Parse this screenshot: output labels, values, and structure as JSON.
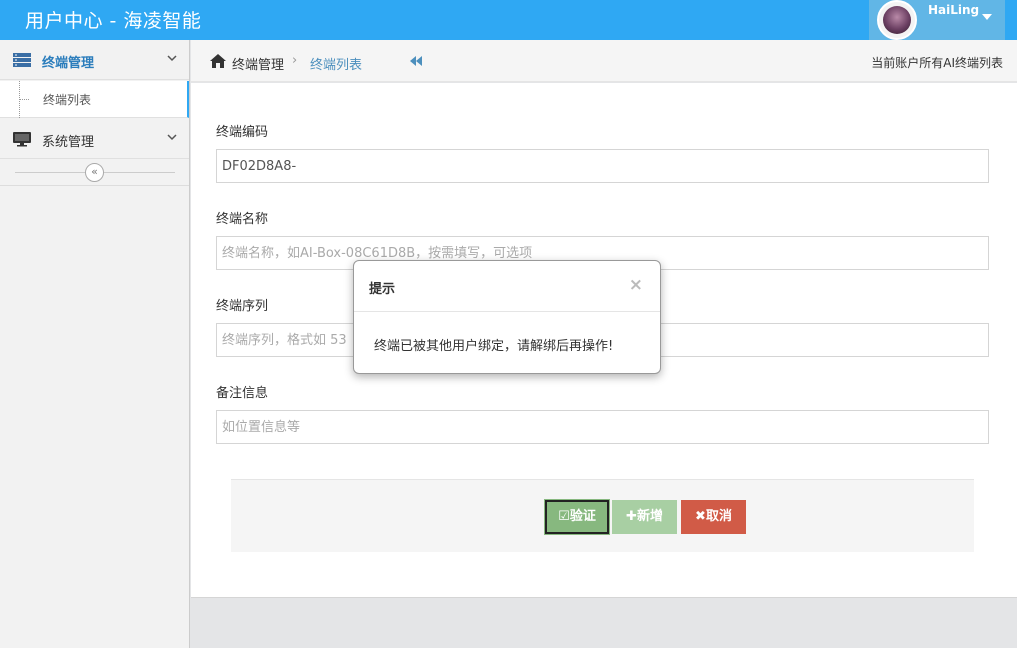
{
  "header": {
    "brand": "用户中心 - 海凌智能",
    "username": "HaiLing"
  },
  "sidebar": {
    "items": [
      {
        "label": "终端管理",
        "icon": "server-icon",
        "expanded": true
      },
      {
        "label": "系统管理",
        "icon": "monitor-icon",
        "expanded": false
      }
    ],
    "subitems": [
      {
        "label": "终端列表"
      }
    ],
    "collapse_icon": "double-chevron-left-icon"
  },
  "breadcrumb": {
    "items": [
      "终端管理",
      "终端列表"
    ],
    "right_text": "当前账户所有AI终端列表"
  },
  "form": {
    "fields": [
      {
        "label": "终端编码",
        "value": "DF02D8A8-",
        "placeholder": ""
      },
      {
        "label": "终端名称",
        "value": "",
        "placeholder": "终端名称，如AI-Box-08C61D8B，按需填写，可选项"
      },
      {
        "label": "终端序列",
        "value": "",
        "placeholder": "终端序列，格式如 53"
      },
      {
        "label": "备注信息",
        "value": "",
        "placeholder": "如位置信息等"
      }
    ],
    "buttons": {
      "verify": "验证",
      "add": "新增",
      "cancel": "取消"
    }
  },
  "modal": {
    "title": "提示",
    "close": "×",
    "message": "终端已被其他用户绑定，请解绑后再操作!"
  },
  "colors": {
    "navbar": "#2fa8f3",
    "link": "#4c8fbd",
    "success": "#87b87f",
    "danger": "#d15b47"
  }
}
